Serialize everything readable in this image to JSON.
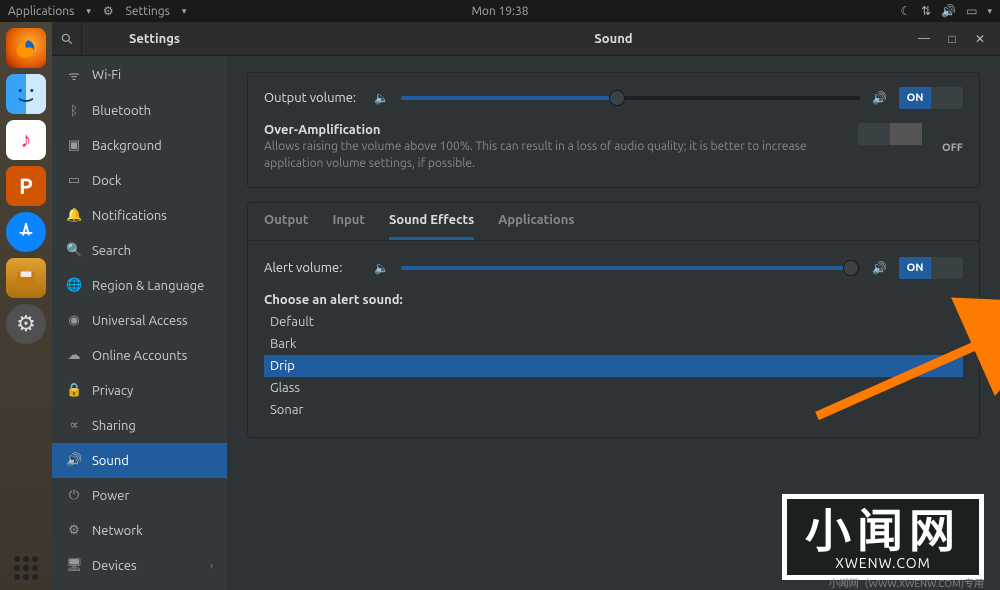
{
  "topbar": {
    "applications": "Applications",
    "app_menu": "Settings",
    "time": "Mon 19:38"
  },
  "window": {
    "sidebar_title": "Settings",
    "title": "Sound",
    "minimize": "—",
    "maximize": "□",
    "close": "✕"
  },
  "sidebar": {
    "items": [
      {
        "icon": "wifi",
        "label": "Wi-Fi"
      },
      {
        "icon": "bluetooth",
        "label": "Bluetooth"
      },
      {
        "icon": "background",
        "label": "Background"
      },
      {
        "icon": "dock",
        "label": "Dock"
      },
      {
        "icon": "notifications",
        "label": "Notifications"
      },
      {
        "icon": "search",
        "label": "Search"
      },
      {
        "icon": "region",
        "label": "Region & Language"
      },
      {
        "icon": "universal",
        "label": "Universal Access"
      },
      {
        "icon": "online",
        "label": "Online Accounts"
      },
      {
        "icon": "privacy",
        "label": "Privacy"
      },
      {
        "icon": "sharing",
        "label": "Sharing"
      },
      {
        "icon": "sound",
        "label": "Sound"
      },
      {
        "icon": "power",
        "label": "Power"
      },
      {
        "icon": "network",
        "label": "Network"
      },
      {
        "icon": "devices",
        "label": "Devices"
      }
    ],
    "active_index": 11
  },
  "main": {
    "output_volume_label": "Output volume:",
    "output_volume_pct": 47,
    "output_toggle_on": true,
    "amp": {
      "title": "Over-Amplification",
      "desc": "Allows raising the volume above 100%. This can result in a loss of audio quality; it is better to increase application volume settings, if possible.",
      "toggle_on": false,
      "off_text": "OFF"
    },
    "tabs": [
      "Output",
      "Input",
      "Sound Effects",
      "Applications"
    ],
    "active_tab": 2,
    "alert_volume_label": "Alert volume:",
    "alert_volume_pct": 98,
    "alert_toggle_on": true,
    "choose_label": "Choose an alert sound:",
    "alerts": [
      "Default",
      "Bark",
      "Drip",
      "Glass",
      "Sonar"
    ],
    "selected_alert": 2,
    "toggle_on_text": "ON",
    "toggle_off_text": ""
  },
  "watermark": {
    "cn": "小闻网",
    "en": "XWENW.COM",
    "footer": "小闻网（WWW.XWENW.COM)专用"
  }
}
